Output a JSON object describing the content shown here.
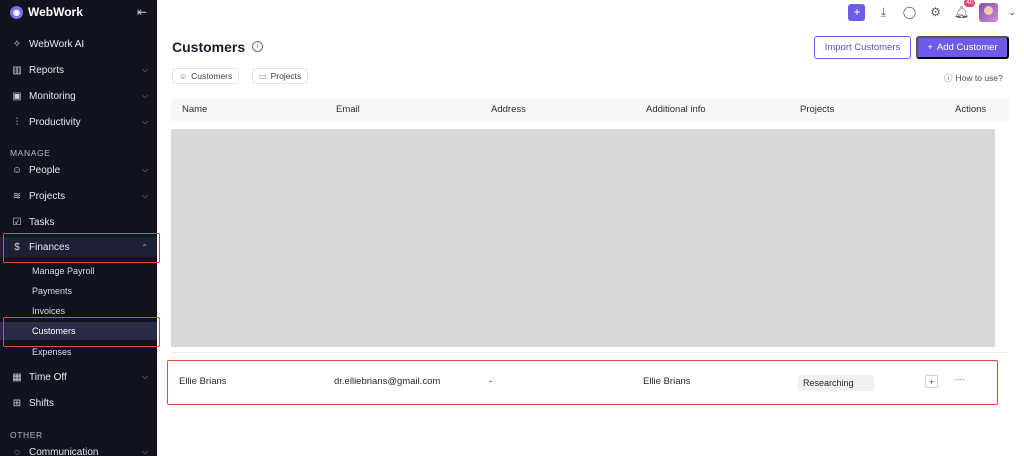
{
  "sidebar": {
    "brand": "WebWork",
    "nav": [
      {
        "label": "WebWork AI",
        "icon": "sparkle-icon"
      },
      {
        "label": "Reports",
        "icon": "chart-icon"
      },
      {
        "label": "Monitoring",
        "icon": "monitor-icon"
      },
      {
        "label": "Productivity",
        "icon": "productivity-icon"
      }
    ],
    "manage_title": "MANAGE",
    "manage": [
      {
        "label": "People"
      },
      {
        "label": "Projects"
      },
      {
        "label": "Tasks"
      },
      {
        "label": "Finances"
      }
    ],
    "finances_sub": [
      "Manage Payroll",
      "Payments",
      "Invoices",
      "Customers",
      "Expenses"
    ],
    "after": [
      {
        "label": "Time Off"
      },
      {
        "label": "Shifts"
      }
    ],
    "other_title": "OTHER",
    "other": [
      {
        "label": "Communication"
      }
    ]
  },
  "topbar": {
    "notifications_count": "40"
  },
  "header": {
    "title": "Customers",
    "import_label": "Import Customers",
    "add_label": "Add Customer"
  },
  "filters": {
    "customers": "Customers",
    "projects": "Projects",
    "how_to": "How to use?"
  },
  "table": {
    "columns": [
      "Name",
      "Email",
      "Address",
      "Additional info",
      "Projects",
      "Actions"
    ],
    "rows": [
      {
        "name": "Ellie Brians",
        "email": "dr.elliebrians@gmail.com",
        "address": "-",
        "info": "Ellie Brians",
        "project": "Researching",
        "more": "···"
      }
    ]
  },
  "colors": {
    "accent": "#6d5ce8",
    "sidebar_bg": "#12131f",
    "highlight": "#e14a3d"
  }
}
